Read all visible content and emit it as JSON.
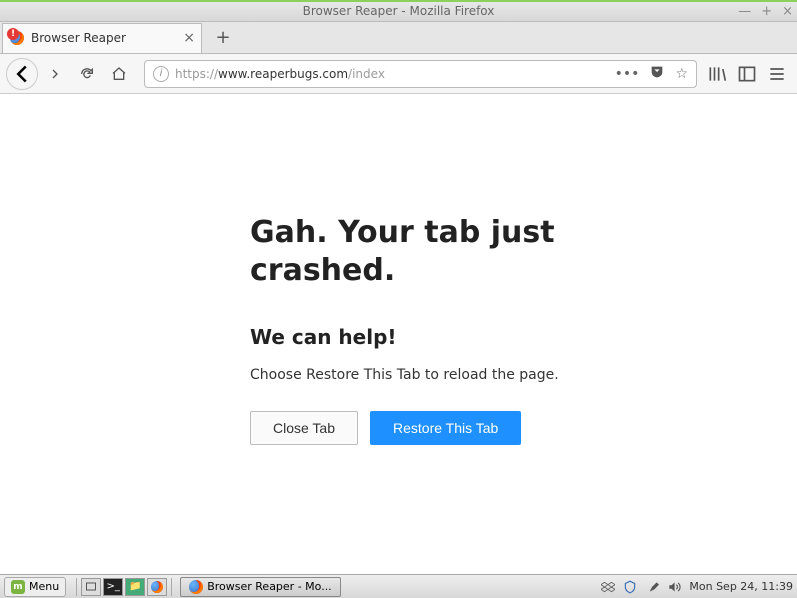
{
  "window": {
    "title": "Browser Reaper - Mozilla Firefox"
  },
  "tab": {
    "label": "Browser Reaper"
  },
  "url": {
    "protocol": "https://",
    "domain": "www.reaperbugs.com",
    "path": "/index"
  },
  "crash": {
    "title": "Gah. Your tab just crashed.",
    "help_title": "We can help!",
    "description": "Choose Restore This Tab to reload the page.",
    "close_label": "Close Tab",
    "restore_label": "Restore This Tab"
  },
  "taskbar": {
    "menu_label": "Menu",
    "task_label": "Browser Reaper - Mo...",
    "clock": "Mon Sep 24, 11:39"
  }
}
